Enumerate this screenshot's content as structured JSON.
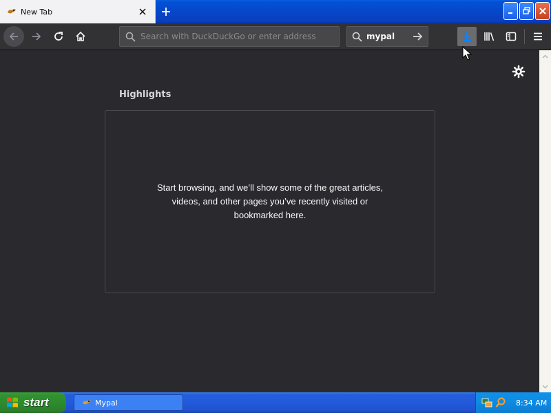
{
  "tab": {
    "title": "New Tab"
  },
  "urlbar": {
    "placeholder": "Search with DuckDuckGo or enter address"
  },
  "searchbar": {
    "text": "mypal"
  },
  "content": {
    "section_title": "Highlights",
    "empty_message": "Start browsing, and we’ll show some of the great articles, videos, and other pages you’ve recently visited or bookmarked here."
  },
  "taskbar": {
    "start_label": "start",
    "task_label": "Mypal",
    "clock": "8:34 AM"
  },
  "icons": {
    "tab": [
      "mypal-favicon-icon",
      "close-icon",
      "plus-icon"
    ],
    "toolbar": [
      "back-arrow-icon",
      "forward-arrow-icon",
      "reload-icon",
      "home-icon",
      "search-icon",
      "arrow-right-icon",
      "download-icon",
      "library-icon",
      "sidebar-icon",
      "hamburger-menu-icon"
    ],
    "content": [
      "gear-icon"
    ],
    "taskbar": [
      "windows-logo-icon",
      "mypal-icon",
      "network-icon",
      "search-tray-icon"
    ]
  },
  "colors": {
    "content_bg": "#2a2a2e",
    "toolbar_bg": "#323234",
    "xp_blue": "#245edc",
    "xp_start_green": "#2e8b2e",
    "download_highlight": "#0a84ff"
  }
}
